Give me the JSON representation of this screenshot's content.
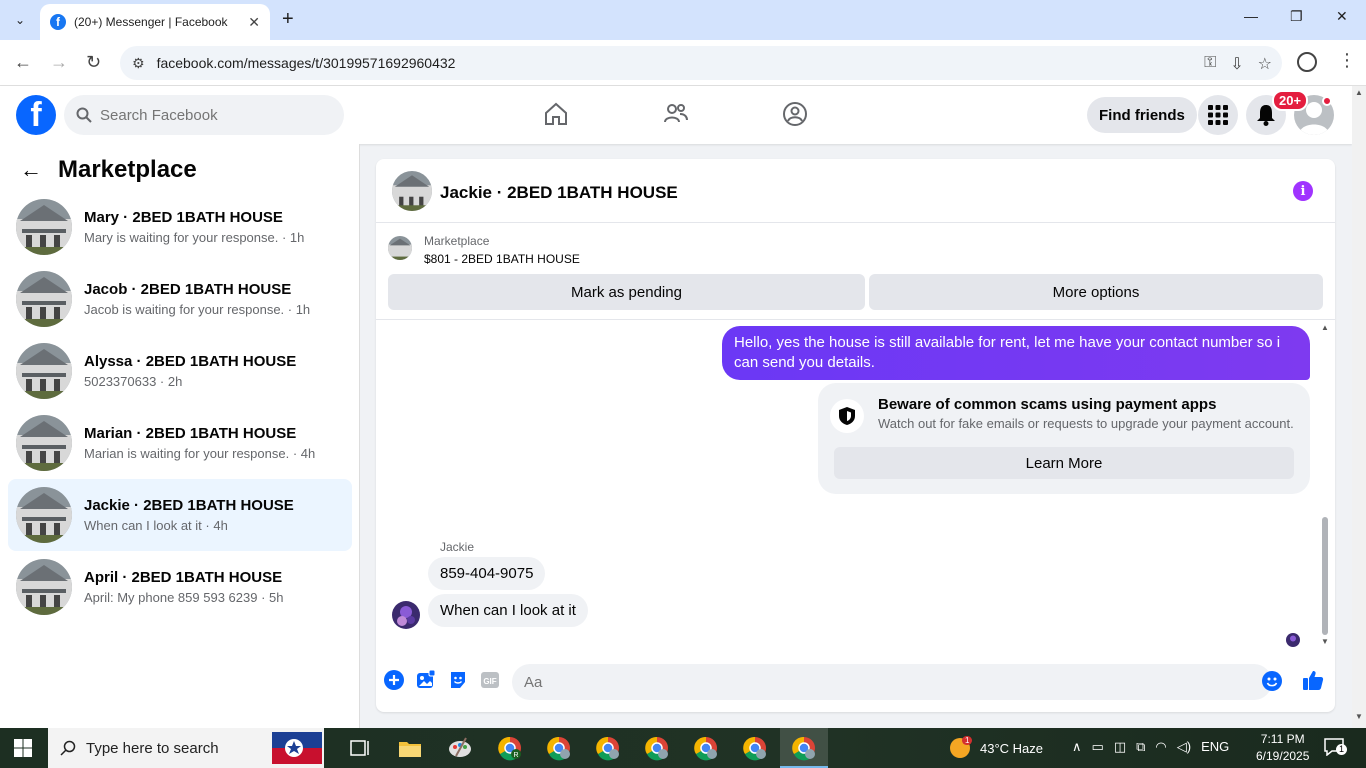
{
  "browser": {
    "tab_title": "(20+) Messenger | Facebook",
    "url": "facebook.com/messages/t/30199571692960432"
  },
  "header": {
    "search_placeholder": "Search Facebook",
    "find_friends": "Find friends",
    "notif_badge": "20+"
  },
  "sidebar": {
    "title": "Marketplace",
    "conversations": [
      {
        "name": "Mary · 2BED 1BATH HOUSE",
        "sub": "Mary is waiting for your response. · 1h"
      },
      {
        "name": "Jacob · 2BED 1BATH HOUSE",
        "sub": "Jacob is waiting for your response. · 1h"
      },
      {
        "name": "Alyssa · 2BED 1BATH HOUSE",
        "sub": "5023370633 · 2h"
      },
      {
        "name": "Marian · 2BED 1BATH HOUSE",
        "sub": "Marian is waiting for your response. · 4h"
      },
      {
        "name": "Jackie · 2BED 1BATH HOUSE",
        "sub": "When can I look at it · 4h"
      },
      {
        "name": "April · 2BED 1BATH HOUSE",
        "sub": "April: My phone 859 593 6239 · 5h"
      }
    ]
  },
  "chat": {
    "title": "Jackie · 2BED 1BATH HOUSE",
    "marketplace_label": "Marketplace",
    "listing": "$801 - 2BED 1BATH HOUSE",
    "mark_pending": "Mark as pending",
    "more_options": "More options",
    "outgoing_message": "Hello, yes the house is still available for rent, let me have your contact number so i can send you details.",
    "scam_title": "Beware of common scams using payment apps",
    "scam_desc": "Watch out for fake emails or requests to upgrade your payment account.",
    "learn_more": "Learn More",
    "sender_label": "Jackie",
    "incoming": [
      "859-404-9075",
      "When can I look at it"
    ],
    "composer_placeholder": "Aa"
  },
  "taskbar": {
    "search_placeholder": "Type here to search",
    "weather": "43°C  Haze",
    "lang": "ENG",
    "time": "7:11 PM",
    "date": "6/19/2025",
    "weather_badge": "1",
    "notif_count": "1"
  },
  "colors": {
    "fb_blue": "#0866ff",
    "bubble_purple": "#7b3ff2",
    "active_row": "#ebf5ff"
  }
}
